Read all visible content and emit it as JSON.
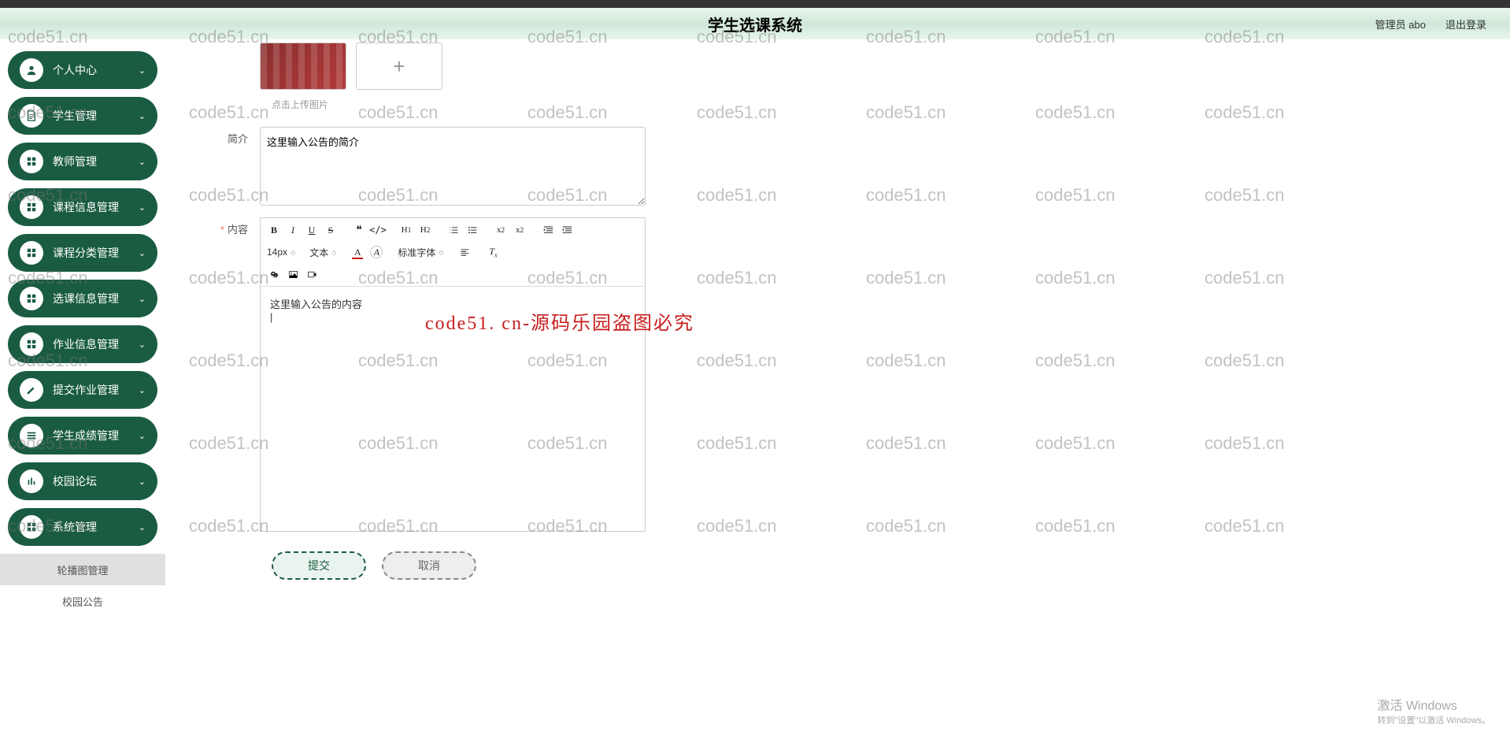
{
  "header": {
    "title": "学生选课系统",
    "user_role": "管理员 abo",
    "logout": "退出登录"
  },
  "sidebar": {
    "items": [
      {
        "label": "个人中心",
        "icon": "user"
      },
      {
        "label": "学生管理",
        "icon": "doc"
      },
      {
        "label": "教师管理",
        "icon": "grid"
      },
      {
        "label": "课程信息管理",
        "icon": "grid"
      },
      {
        "label": "课程分类管理",
        "icon": "grid"
      },
      {
        "label": "选课信息管理",
        "icon": "grid"
      },
      {
        "label": "作业信息管理",
        "icon": "grid"
      },
      {
        "label": "提交作业管理",
        "icon": "pencil"
      },
      {
        "label": "学生成绩管理",
        "icon": "list"
      },
      {
        "label": "校园论坛",
        "icon": "bars"
      },
      {
        "label": "系统管理",
        "icon": "grid"
      }
    ],
    "sub_items": [
      {
        "label": "轮播图管理",
        "active": true
      },
      {
        "label": "校园公告",
        "active": false
      }
    ]
  },
  "form": {
    "upload_hint": "点击上传图片",
    "intro_label": "简介",
    "intro_value": "这里输入公告的简介",
    "content_label": "内容",
    "content_required": "*",
    "content_placeholder": "这里输入公告的内容",
    "editor": {
      "font_size": "14px",
      "font_type": "文本",
      "font_family": "标准字体"
    },
    "buttons": {
      "submit": "提交",
      "cancel": "取消"
    }
  },
  "watermark": {
    "text": "code51.cn",
    "center": "code51. cn-源码乐园盗图必究"
  },
  "windows": {
    "activate_title": "激活 Windows",
    "activate_sub": "转到\"设置\"以激活 Windows。"
  }
}
